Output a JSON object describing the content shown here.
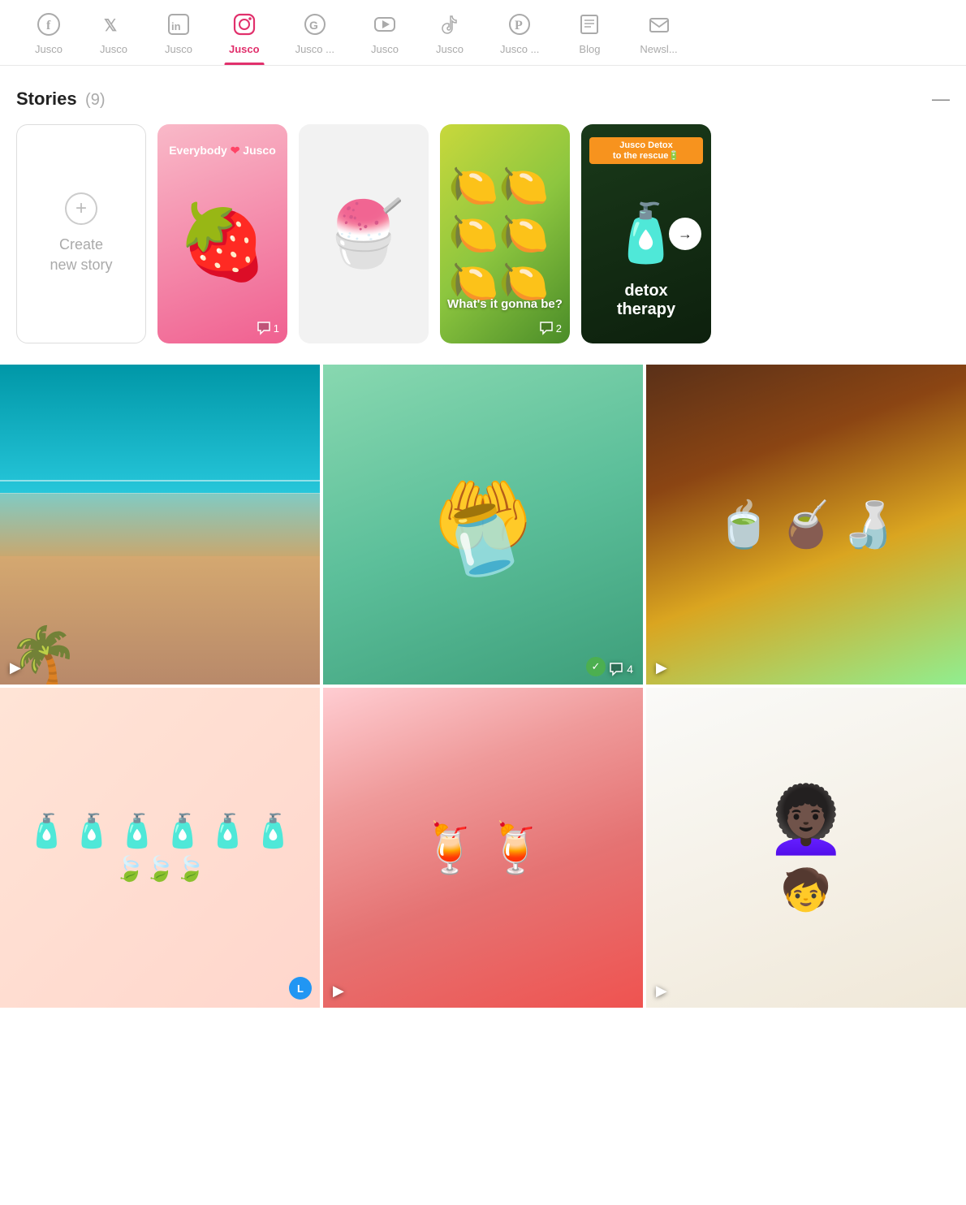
{
  "nav": {
    "tabs": [
      {
        "id": "facebook",
        "label": "Jusco",
        "icon": "facebook",
        "active": false
      },
      {
        "id": "twitter",
        "label": "Jusco",
        "icon": "twitter",
        "active": false
      },
      {
        "id": "linkedin",
        "label": "Jusco",
        "icon": "linkedin",
        "active": false
      },
      {
        "id": "instagram",
        "label": "Jusco",
        "icon": "instagram",
        "active": true
      },
      {
        "id": "google",
        "label": "Jusco ...",
        "icon": "google",
        "active": false
      },
      {
        "id": "youtube",
        "label": "Jusco",
        "icon": "youtube",
        "active": false
      },
      {
        "id": "tiktok",
        "label": "Jusco",
        "icon": "tiktok",
        "active": false
      },
      {
        "id": "pinterest",
        "label": "Jusco ...",
        "icon": "pinterest",
        "active": false
      },
      {
        "id": "blog",
        "label": "Blog",
        "icon": "blog",
        "active": false
      },
      {
        "id": "newsletter",
        "label": "Newsl...",
        "icon": "newsletter",
        "active": false
      }
    ]
  },
  "stories": {
    "title": "Stories",
    "count": "(9)",
    "create_label": "Create\nnew story",
    "cards": [
      {
        "id": "create",
        "type": "create"
      },
      {
        "id": "strawberry",
        "type": "strawberry",
        "top_text": "Everybody ❤ Jusco",
        "comments": 1
      },
      {
        "id": "blueberry",
        "type": "blueberry"
      },
      {
        "id": "lemon",
        "type": "lemon",
        "middle_text": "What's it gonna be?",
        "comments": 2
      },
      {
        "id": "detox",
        "type": "detox",
        "badge_text": "Jusco Detox\nto the rescue🔋",
        "bottle_text": "detox\ntherapy"
      }
    ]
  },
  "posts": [
    {
      "id": "beach",
      "type": "beach",
      "has_play": true
    },
    {
      "id": "bottle",
      "type": "bottle",
      "has_play": false,
      "has_check": true,
      "comments": 4
    },
    {
      "id": "smoothies",
      "type": "smoothies",
      "has_play": true
    },
    {
      "id": "juice-bottles",
      "type": "juice-bottles",
      "has_play": false,
      "has_label": "L"
    },
    {
      "id": "red-drinks",
      "type": "red-drinks",
      "has_play": true
    },
    {
      "id": "family",
      "type": "family",
      "has_play": true
    }
  ],
  "icons": {
    "facebook": "f",
    "comment_bubble": "💬",
    "play": "▶",
    "check": "✓",
    "plus": "+",
    "arrow_right": "→",
    "minus": "—"
  }
}
